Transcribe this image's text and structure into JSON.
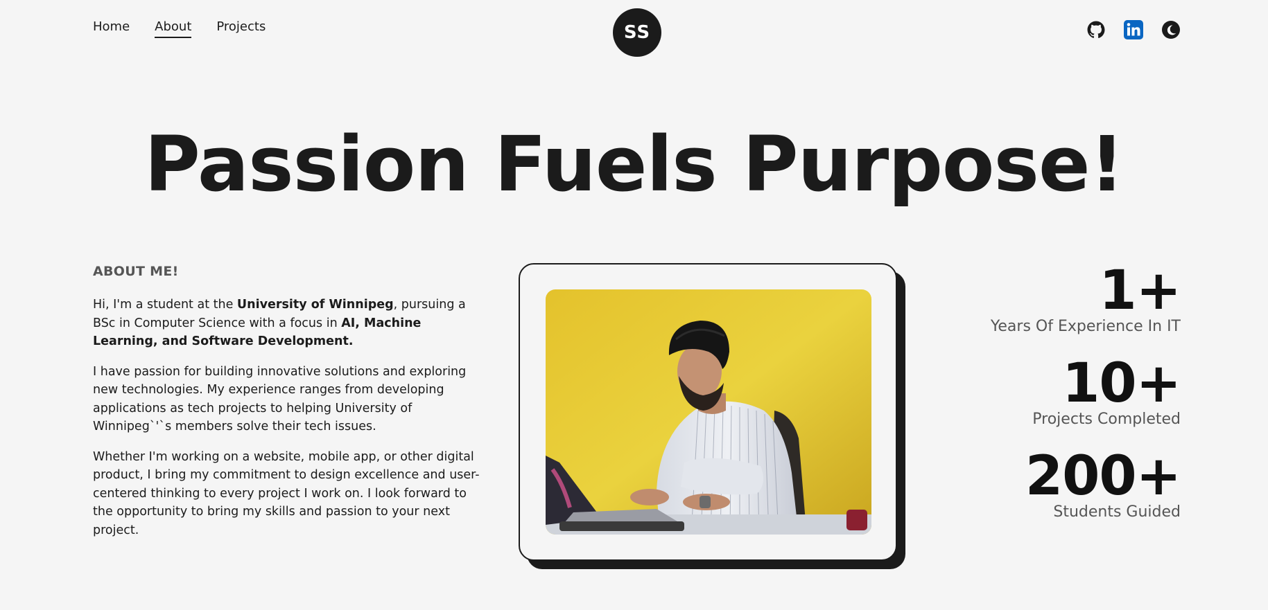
{
  "nav": {
    "items": [
      {
        "label": "Home",
        "active": false
      },
      {
        "label": "About",
        "active": true
      },
      {
        "label": "Projects",
        "active": false
      }
    ]
  },
  "logo": {
    "text": "SS"
  },
  "social": {
    "icons": [
      "github-icon",
      "linkedin-icon",
      "moon-icon"
    ],
    "linkedin_color": "#0a66c2"
  },
  "hero": {
    "title": "Passion Fuels Purpose!"
  },
  "about": {
    "heading": "ABOUT ME!",
    "p1": {
      "t1": "Hi, I'm a student at the ",
      "b1": "University of Winnipeg",
      "t2": ", pursuing a BSc in Computer Science with a focus in ",
      "b2": "AI, Machine Learning, and Software Development."
    },
    "p2": "I have passion for building innovative solutions and exploring new technologies. My experience ranges from developing applications as tech projects to helping University of Winnipeg`'`s members solve their tech issues.",
    "p3": "Whether I'm working on a website, mobile app, or other digital product, I bring my commitment to design excellence and user-centered thinking to every project I work on. I look forward to the opportunity to bring my skills and passion to your next project."
  },
  "stats": [
    {
      "value": "1+",
      "label": "Years Of Experience In IT"
    },
    {
      "value": "10+",
      "label": "Projects Completed"
    },
    {
      "value": "200+",
      "label": "Students Guided"
    }
  ],
  "colors": {
    "background": "#f5f5f5",
    "text": "#1b1b1b",
    "muted": "#555555",
    "photo_wall": "#e9c732"
  }
}
